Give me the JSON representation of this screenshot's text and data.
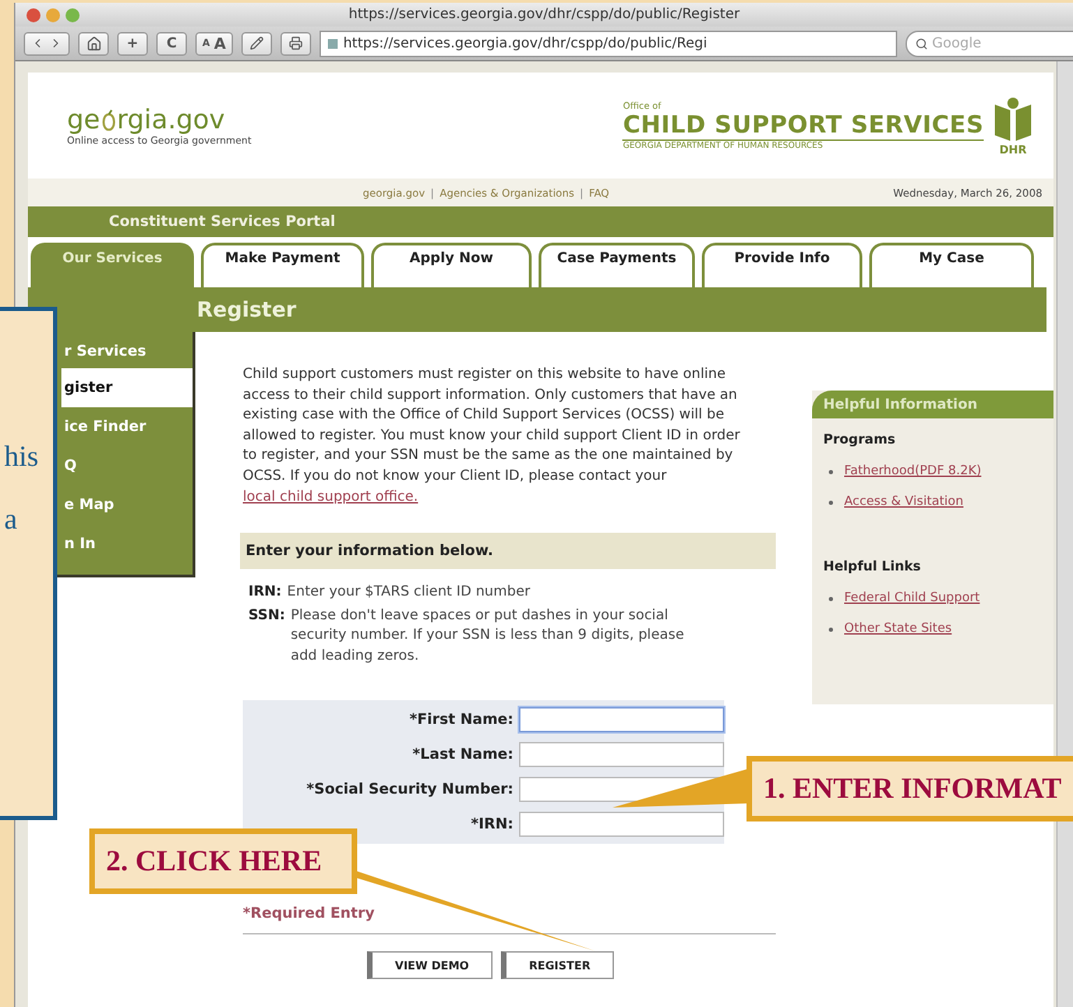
{
  "window": {
    "title": "https://services.georgia.gov/dhr/cspp/do/public/Register"
  },
  "toolbar": [
    {
      "kind": "nav"
    },
    {
      "kind": "home"
    },
    {
      "kind": "text",
      "label": "+"
    },
    {
      "kind": "text",
      "label": "C"
    },
    {
      "kind": "textsize",
      "small": "A",
      "large": "A"
    },
    {
      "kind": "edit"
    },
    {
      "kind": "print"
    }
  ],
  "address": {
    "value": "https://services.georgia.gov/dhr/cspp/do/public/Regi"
  },
  "search": {
    "placeholder": "Google"
  },
  "header": {
    "logo_left": [
      "ge",
      "rgia.gov"
    ],
    "logo_tagline": "Online access to Georgia government",
    "office_of": "Office of",
    "agency": "CHILD SUPPORT SERVICES",
    "department": "GEORGIA DEPARTMENT OF HUMAN RESOURCES",
    "emblem": "DHR"
  },
  "top_links": [
    {
      "label": "georgia.gov"
    },
    {
      "label": "Agencies & Organizations"
    },
    {
      "label": "FAQ"
    }
  ],
  "top_links_separator": "|",
  "date": "Wednesday, March 26, 2008",
  "portal_title": "Constituent Services Portal",
  "tabs": [
    {
      "label": "Our Services",
      "selected": true
    },
    {
      "label": "Make Payment",
      "selected": false
    },
    {
      "label": "Apply Now",
      "selected": false
    },
    {
      "label": "Case Payments",
      "selected": false
    },
    {
      "label": "Provide Info",
      "selected": false
    },
    {
      "label": "My Case",
      "selected": false
    }
  ],
  "sidebar": {
    "heading": "r Services",
    "items": [
      {
        "label": "gister",
        "selected": true
      },
      {
        "label": "ice Finder",
        "selected": false
      },
      {
        "label": "Q",
        "selected": false
      },
      {
        "label": "e Map",
        "selected": false
      },
      {
        "label": "n In",
        "selected": false
      }
    ]
  },
  "page_title": "Register",
  "intro": {
    "text": "Child support customers must register on this website to have online access to their child support information. Only customers that have an existing case with the Office of Child Support Services (OCSS) will be allowed to register. You must know your child support Client ID in order to register, and your SSN must be the same as the one maintained by OCSS. If you do not know your Client ID, please contact your",
    "link": "local child support office."
  },
  "form_heading": "Enter your information below.",
  "notes": [
    {
      "term": "IRN:",
      "text": "Enter your $TARS client ID number"
    },
    {
      "term": "SSN:",
      "text": "Please don't leave spaces or put dashes in your social security number. If your SSN is less than 9 digits, please add leading zeros."
    }
  ],
  "fields": [
    {
      "label": "*First Name:",
      "focused": true
    },
    {
      "label": "*Last Name:",
      "focused": false
    },
    {
      "label": "*Social Security Number:",
      "focused": false
    },
    {
      "label": "*IRN:",
      "focused": false
    }
  ],
  "required_note": "*Required Entry",
  "buttons": [
    "VIEW DEMO",
    "REGISTER"
  ],
  "side_panel": {
    "title": "Helpful Information",
    "sections": [
      {
        "heading": "Programs",
        "links": [
          "Fatherhood(PDF 8.2K)",
          "Access & Visitation"
        ]
      },
      {
        "heading": "Helpful Links",
        "links": [
          "Federal Child Support",
          "Other State Sites"
        ]
      }
    ]
  },
  "callouts": [
    {
      "kind": "note",
      "lines": [
        "his",
        "a"
      ]
    },
    {
      "kind": "step",
      "text": "1. ENTER INFORMAT"
    },
    {
      "kind": "step",
      "text": "2. CLICK HERE"
    }
  ]
}
